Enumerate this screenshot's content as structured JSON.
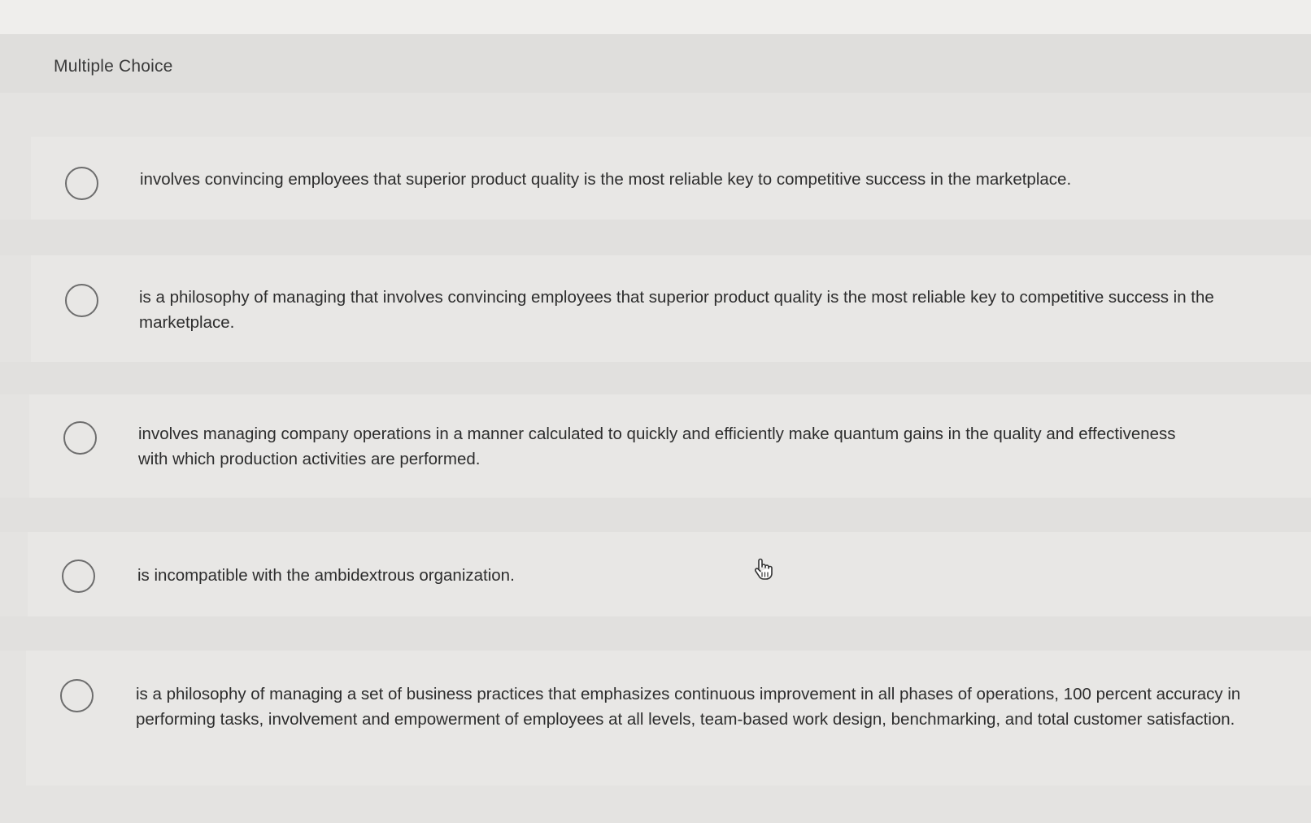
{
  "question": {
    "type_label": "Multiple Choice"
  },
  "options": [
    {
      "text": "involves convincing employees that superior product quality is the most reliable key to competitive success in the marketplace."
    },
    {
      "text": "is a philosophy of managing that involves convincing employees that superior product quality is the most reliable key to competitive success in the marketplace."
    },
    {
      "text": "involves managing company operations in a manner calculated to quickly and efficiently make quantum gains in the quality and effectiveness with which production activities are performed."
    },
    {
      "text": "is incompatible with the ambidextrous organization."
    },
    {
      "text": "is a philosophy of managing a set of business practices that emphasizes continuous improvement in all phases of operations, 100 percent accuracy in performing tasks, involvement and empowerment of employees at all levels, team-based work design, benchmarking, and total customer satisfaction."
    }
  ],
  "cursor_icon": "hand-pointer-icon"
}
